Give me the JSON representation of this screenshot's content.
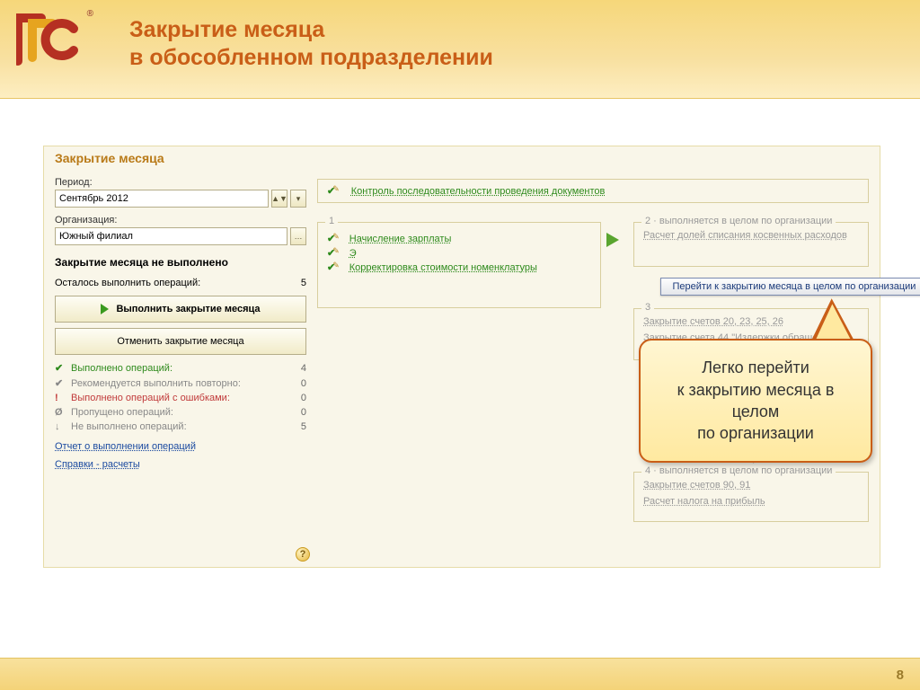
{
  "slide": {
    "title_line1": "Закрытие месяца",
    "title_line2": "в обособленном подразделении",
    "page_number": "8"
  },
  "panel": {
    "title": "Закрытие месяца",
    "period_label": "Период:",
    "period_value": "Сентябрь 2012",
    "org_label": "Организация:",
    "org_value": "Южный филиал",
    "status": "Закрытие месяца не выполнено",
    "remaining_label": "Осталось выполнить операций:",
    "remaining_value": "5",
    "execute_btn": "Выполнить закрытие месяца",
    "cancel_btn": "Отменить закрытие месяца",
    "stats": [
      {
        "icon": "✔",
        "cls": "ok",
        "label": "Выполнено операций:",
        "value": "4"
      },
      {
        "icon": "✔",
        "cls": "",
        "label": "Рекомендуется выполнить повторно:",
        "value": "0"
      },
      {
        "icon": "!",
        "cls": "err",
        "label": "Выполнено операций с ошибками:",
        "value": "0"
      },
      {
        "icon": "Ø",
        "cls": "",
        "label": "Пропущено операций:",
        "value": "0"
      },
      {
        "icon": "↓",
        "cls": "",
        "label": "Не выполнено операций:",
        "value": "5"
      }
    ],
    "report_link": "Отчет о выполнении операций",
    "ref_link": "Справки - расчеты"
  },
  "ops": {
    "control": "Контроль последовательности проведения документов",
    "group1": {
      "legend": "1",
      "items": [
        "Начисление зарплаты",
        "Э",
        "Корректировка стоимости номенклатуры"
      ]
    },
    "group2": {
      "legend": "2 · выполняется в целом по организации",
      "item": "Расчет долей списания косвенных расходов"
    },
    "group3": {
      "legend": "3",
      "item1": "Закрытие счетов 20, 23, 25, 26",
      "item2": "Закрытие счета 44 \"Издержки обращения\""
    },
    "group4": {
      "legend": "4 · выполняется в целом по организации",
      "item1": "Закрытие счетов 90, 91",
      "item2": "Расчет налога на прибыль"
    }
  },
  "tooltip": "Перейти к закрытию месяца в целом по организации",
  "callout": {
    "l1": "Легко перейти",
    "l2": "к закрытию месяца в",
    "l3": "целом",
    "l4": "по организации"
  }
}
